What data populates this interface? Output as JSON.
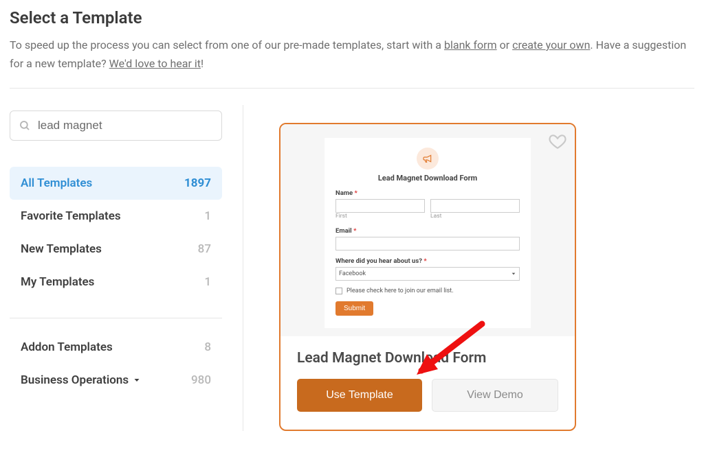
{
  "header": {
    "title": "Select a Template",
    "intro_prefix": "To speed up the process you can select from one of our pre-made templates, start with a ",
    "link_blank": "blank form",
    "intro_mid": " or ",
    "link_create": "create your own",
    "intro_period": ". Have a suggestion for a new template? ",
    "link_feedback": "We'd love to hear it",
    "intro_bang": "!"
  },
  "search": {
    "value": "lead magnet"
  },
  "categories": {
    "main": [
      {
        "label": "All Templates",
        "count": "1897",
        "active": true
      },
      {
        "label": "Favorite Templates",
        "count": "1"
      },
      {
        "label": "New Templates",
        "count": "87"
      },
      {
        "label": "My Templates",
        "count": "1"
      }
    ],
    "more": [
      {
        "label": "Addon Templates",
        "count": "8"
      },
      {
        "label": "Business Operations",
        "count": "980",
        "chevron": true
      }
    ]
  },
  "card": {
    "preview": {
      "title": "Lead Magnet Download Form",
      "name_label": "Name",
      "first_sub": "First",
      "last_sub": "Last",
      "email_label": "Email",
      "hear_label": "Where did you hear about us?",
      "hear_value": "Facebook",
      "checkbox_text": "Please check here to join our email list.",
      "submit": "Submit"
    },
    "title": "Lead Magnet Download Form",
    "use_template": "Use Template",
    "view_demo": "View Demo"
  }
}
